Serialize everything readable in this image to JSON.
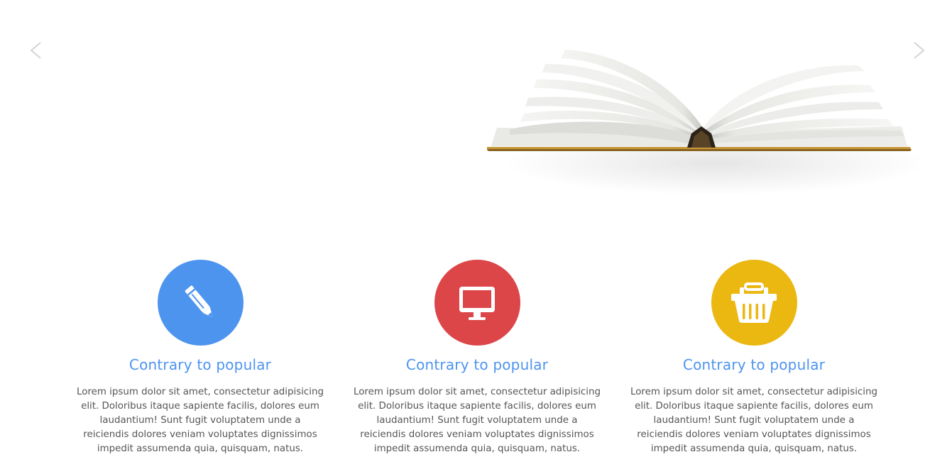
{
  "slider": {
    "prev_icon": "chevron-left-icon",
    "next_icon": "chevron-right-icon",
    "image": "open-book-image"
  },
  "features": [
    {
      "icon": "pencil-icon",
      "color": "#4d94ef",
      "title": "Contrary to popular",
      "text": "Lorem ipsum dolor sit amet, consectetur adipisicing elit. Doloribus itaque sapiente facilis, dolores eum laudantium! Sunt fugit voluptatem unde a reiciendis dolores veniam voluptates dignissimos impedit assumenda quia, quisquam, natus."
    },
    {
      "icon": "monitor-icon",
      "color": "#dc4649",
      "title": "Contrary to popular",
      "text": "Lorem ipsum dolor sit amet, consectetur adipisicing elit. Doloribus itaque sapiente facilis, dolores eum laudantium! Sunt fugit voluptatem unde a reiciendis dolores veniam voluptates dignissimos impedit assumenda quia, quisquam, natus."
    },
    {
      "icon": "basket-icon",
      "color": "#ebb711",
      "title": "Contrary to popular",
      "text": "Lorem ipsum dolor sit amet, consectetur adipisicing elit. Doloribus itaque sapiente facilis, dolores eum laudantium! Sunt fugit voluptatem unde a reiciendis dolores veniam voluptates dignissimos impedit assumenda quia, quisquam, natus."
    }
  ],
  "colors": {
    "title": "#4d94ef",
    "text": "#555555",
    "arrow": "#d4d4d4"
  }
}
